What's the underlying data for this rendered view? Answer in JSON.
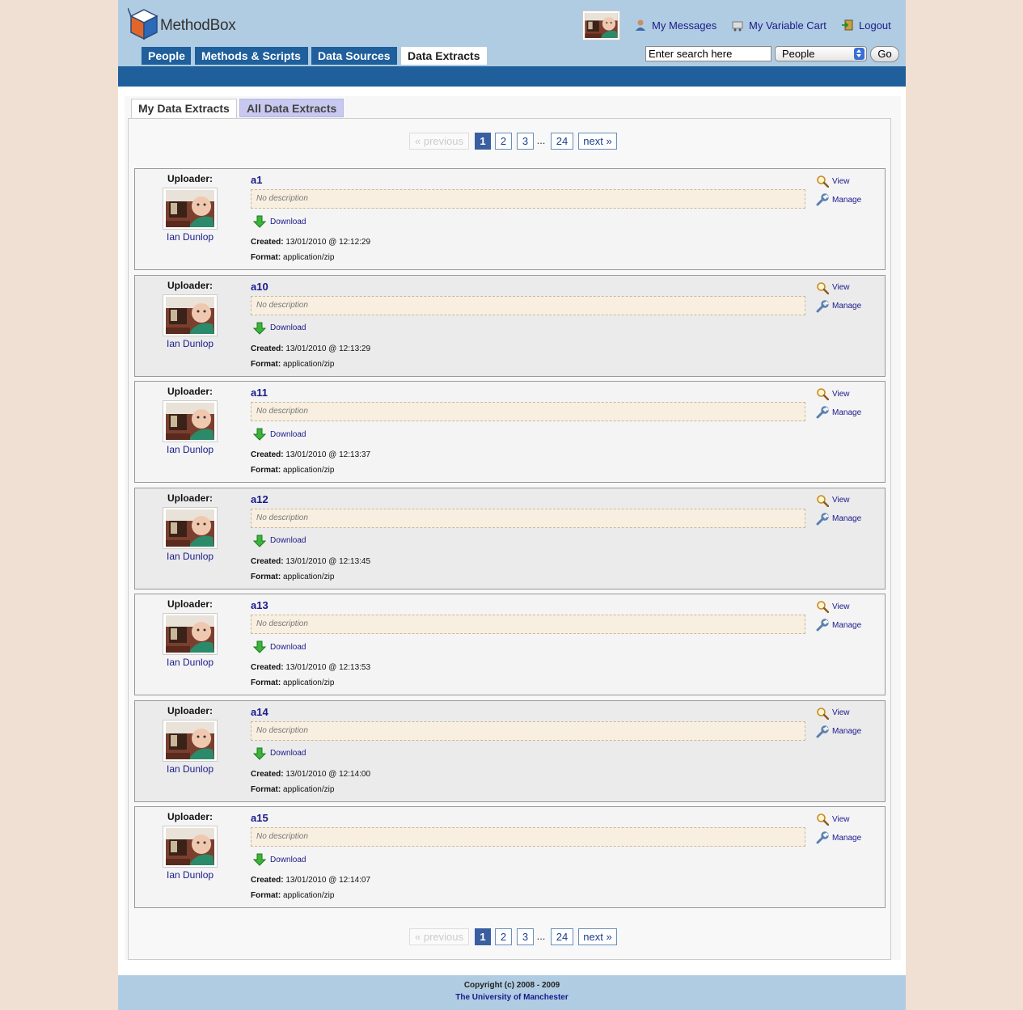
{
  "brand": {
    "name": "MethodBox"
  },
  "nav": {
    "tabs": [
      {
        "label": "People"
      },
      {
        "label": "Methods & Scripts"
      },
      {
        "label": "Data Sources"
      },
      {
        "label": "Data Extracts"
      }
    ],
    "active_tab": "Data Extracts"
  },
  "user_links": {
    "messages": "My Messages",
    "cart": "My Variable Cart",
    "logout": "Logout"
  },
  "search": {
    "placeholder": "Enter search here",
    "value": "Enter search here",
    "scope": "People",
    "go_label": "Go"
  },
  "subtabs": {
    "mine": "My Data Extracts",
    "all": "All Data Extracts"
  },
  "pager": {
    "prev": "« previous",
    "pages": [
      "1",
      "2",
      "3"
    ],
    "dots": "...",
    "last": "24",
    "next": "next »",
    "current": "1"
  },
  "labels": {
    "uploader": "Uploader:",
    "no_description": "No description",
    "download": "Download",
    "created": "Created:",
    "format": "Format:",
    "view": "View",
    "manage": "Manage"
  },
  "items": [
    {
      "title": "a1",
      "uploader": "Ian Dunlop",
      "created": "13/01/2010 @ 12:12:29",
      "format": "application/zip"
    },
    {
      "title": "a10",
      "uploader": "Ian Dunlop",
      "created": "13/01/2010 @ 12:13:29",
      "format": "application/zip"
    },
    {
      "title": "a11",
      "uploader": "Ian Dunlop",
      "created": "13/01/2010 @ 12:13:37",
      "format": "application/zip"
    },
    {
      "title": "a12",
      "uploader": "Ian Dunlop",
      "created": "13/01/2010 @ 12:13:45",
      "format": "application/zip"
    },
    {
      "title": "a13",
      "uploader": "Ian Dunlop",
      "created": "13/01/2010 @ 12:13:53",
      "format": "application/zip"
    },
    {
      "title": "a14",
      "uploader": "Ian Dunlop",
      "created": "13/01/2010 @ 12:14:00",
      "format": "application/zip"
    },
    {
      "title": "a15",
      "uploader": "Ian Dunlop",
      "created": "13/01/2010 @ 12:14:07",
      "format": "application/zip"
    }
  ],
  "footer": {
    "copyright": "Copyright (c) 2008 - 2009",
    "university": "The University of Manchester"
  },
  "colors": {
    "header_bg": "#b0cce2",
    "nav_blue": "#1f5f9b",
    "link": "#1a1a8c",
    "page_bg": "#f0e0d4"
  }
}
